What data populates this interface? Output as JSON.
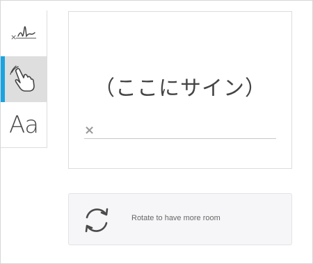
{
  "tools": [
    {
      "name": "draw",
      "icon": "signature-draw-icon"
    },
    {
      "name": "touch",
      "icon": "hand-pointer-icon",
      "active": true
    },
    {
      "name": "type",
      "label": "Aa"
    }
  ],
  "signature": {
    "placeholder": "（ここにサイン）",
    "clear_icon": "×"
  },
  "rotate": {
    "icon": "rotate-icon",
    "text": "Rotate to have more room"
  },
  "colors": {
    "accent": "#1aa3e0",
    "active_bg": "#dedede"
  }
}
